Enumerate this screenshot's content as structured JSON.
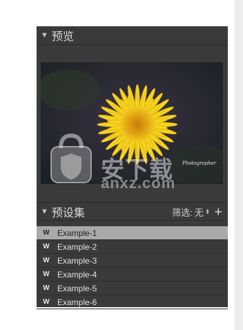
{
  "preview": {
    "title": "预览",
    "image_caption": "Photographer"
  },
  "presets": {
    "title": "预设集",
    "filter_label": "筛选:",
    "filter_value": "无",
    "add_icon": "plus-icon",
    "items": [
      {
        "label": "Example-1",
        "icon": "w-icon",
        "selected": true
      },
      {
        "label": "Example-2",
        "icon": "w-icon",
        "selected": false
      },
      {
        "label": "Example-3",
        "icon": "w-icon",
        "selected": false
      },
      {
        "label": "Example-4",
        "icon": "w-icon",
        "selected": false
      },
      {
        "label": "Example-5",
        "icon": "w-icon",
        "selected": false
      },
      {
        "label": "Example-6",
        "icon": "w-icon",
        "selected": false
      }
    ]
  },
  "watermark": {
    "text": "安下载",
    "sub": "anxz.com"
  },
  "colors": {
    "panel_bg": "#3a3a3a",
    "selected_bg": "#a9a9a9",
    "flower": "#f5d21e"
  }
}
